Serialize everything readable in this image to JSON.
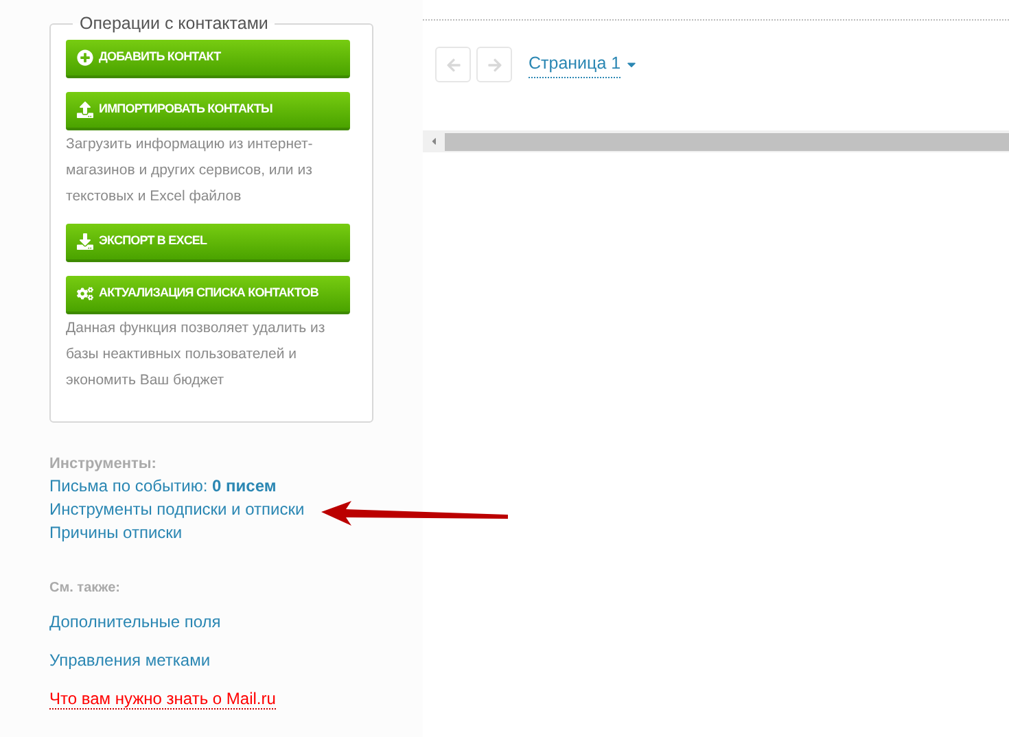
{
  "operations": {
    "legend": "Операции с контактами",
    "buttons": [
      {
        "label": "ДОБАВИТЬ КОНТАКТ",
        "kind": "plus"
      },
      {
        "label": "ИМПОРТИРОВАТЬ КОНТАКТЫ",
        "kind": "upload",
        "description": "Загрузить информацию из интернет-магазинов и других сервисов, или из текстовых и Excel файлов"
      },
      {
        "label": "ЭКСПОРТ В EXCEL",
        "kind": "download"
      },
      {
        "label": "АКТУАЛИЗАЦИЯ СПИСКА КОНТАКТОВ",
        "kind": "gears",
        "description": "Данная функция позволяет удалить из базы неактивных пользователей и экономить Ваш бюджет"
      }
    ]
  },
  "tools": {
    "title": "Инструменты:",
    "links": [
      {
        "text": "Письма по событию: **0 писем**"
      },
      {
        "text": "Инструменты подписки и отписки"
      },
      {
        "text": "Причины отписки"
      }
    ]
  },
  "see_also": {
    "title": "См. также:",
    "links": [
      {
        "text": "Дополнительные поля",
        "highlighted": false
      },
      {
        "text": "Управления метками",
        "highlighted": false
      },
      {
        "text": "Что вам нужно знать о Mail.ru",
        "highlighted": true
      }
    ]
  },
  "pagination": {
    "prev_disabled": true,
    "next_disabled": true,
    "page": "Страница 1"
  }
}
